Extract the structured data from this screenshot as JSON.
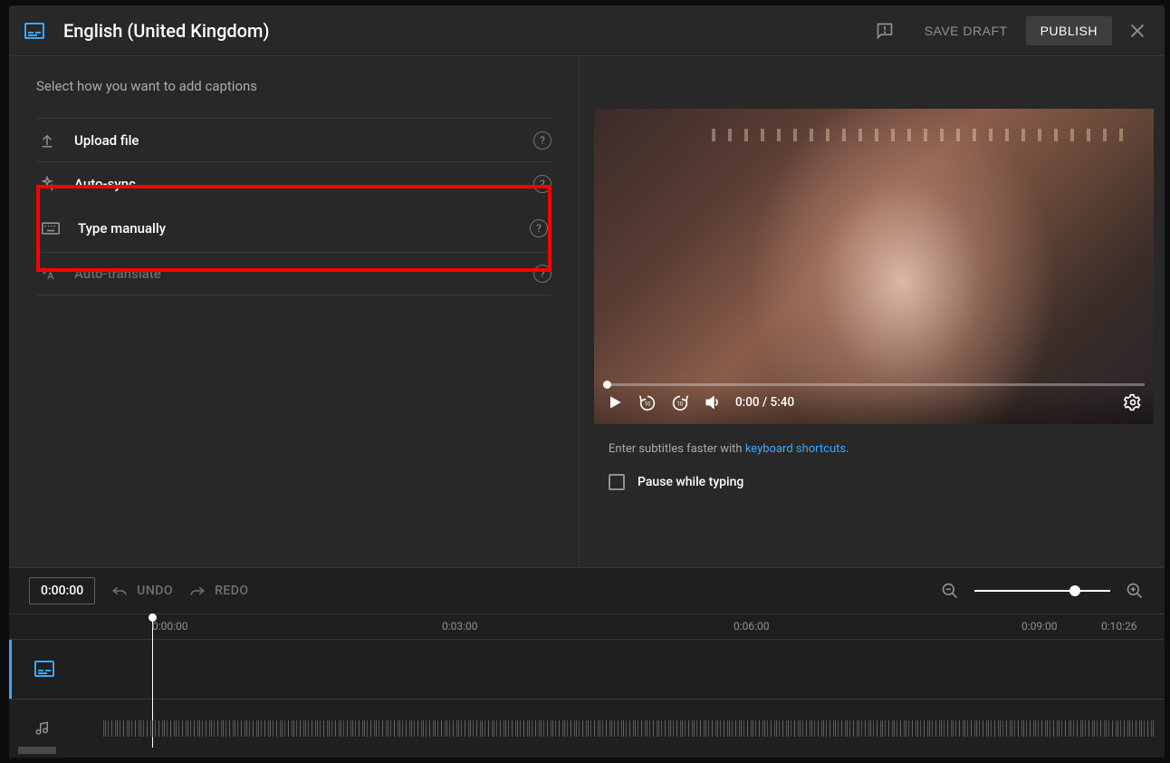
{
  "header": {
    "title": "English (United Kingdom)",
    "save_draft": "SAVE DRAFT",
    "publish": "PUBLISH"
  },
  "left": {
    "prompt": "Select how you want to add captions",
    "options": [
      {
        "label": "Upload file",
        "icon": "upload-icon",
        "disabled": false
      },
      {
        "label": "Auto-sync",
        "icon": "sparkle-icon",
        "disabled": false
      },
      {
        "label": "Type manually",
        "icon": "keyboard-icon",
        "disabled": false,
        "highlighted": true
      },
      {
        "label": "Auto-translate",
        "icon": "translate-icon",
        "disabled": true
      }
    ]
  },
  "video": {
    "current_time": "0:00",
    "duration": "5:40",
    "time_display": "0:00 / 5:40"
  },
  "hint": {
    "prefix": "Enter subtitles faster with ",
    "link": "keyboard shortcuts",
    "suffix": "."
  },
  "pause_label": "Pause while typing",
  "timeline": {
    "current": "0:00:00",
    "undo": "UNDO",
    "redo": "REDO",
    "ticks": [
      "0:00:00",
      "0:03:00",
      "0:06:00",
      "0:09:00",
      "0:10:26"
    ]
  }
}
